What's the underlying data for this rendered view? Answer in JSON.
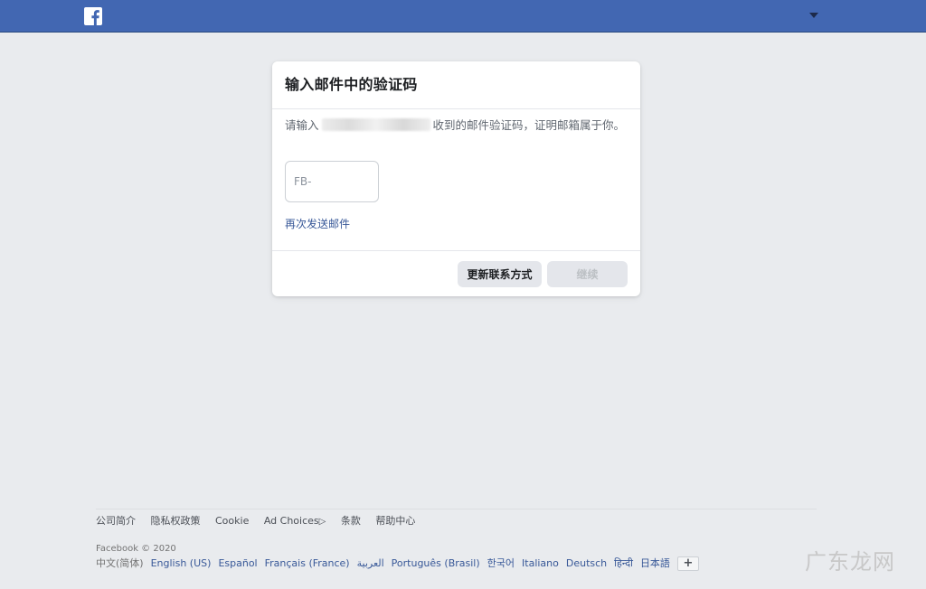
{
  "header": {
    "logo_icon": "facebook-logo-icon",
    "menu_icon": "caret-down-icon",
    "brand_color": "#4267b2"
  },
  "dialog": {
    "title": "输入邮件中的验证码",
    "description_prefix": "请输入",
    "description_suffix": "收到的邮件验证码，证明邮箱属于你。",
    "code_placeholder": "FB-",
    "code_value": "",
    "resend_label": "再次发送邮件",
    "update_contact_label": "更新联系方式",
    "continue_label": "继续"
  },
  "footer": {
    "links": [
      "公司简介",
      "隐私权政策",
      "Cookie",
      "Ad Choices",
      "条款",
      "帮助中心"
    ],
    "adchoices_icon": "ad-choices-icon",
    "copyright": "Facebook © 2020",
    "current_language": "中文(简体)",
    "languages": [
      "English (US)",
      "Español",
      "Français (France)",
      "العربية",
      "Português (Brasil)",
      "한국어",
      "Italiano",
      "Deutsch",
      "हिन्दी",
      "日本語"
    ],
    "more_languages_label": "+"
  },
  "watermark": "广东龙网"
}
